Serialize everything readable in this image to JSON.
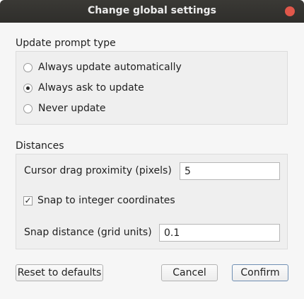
{
  "window": {
    "title": "Change global settings"
  },
  "update_prompt": {
    "heading": "Update prompt type",
    "options": [
      {
        "label": "Always update automatically",
        "selected": false
      },
      {
        "label": "Always ask to update",
        "selected": true
      },
      {
        "label": "Never update",
        "selected": false
      }
    ]
  },
  "distances": {
    "heading": "Distances",
    "drag_proximity": {
      "label": "Cursor drag proximity (pixels)",
      "value": "5"
    },
    "snap_checkbox": {
      "label": "Snap to integer coordinates",
      "checked": true,
      "mark": "✓"
    },
    "snap_distance": {
      "label": "Snap distance (grid units)",
      "value": "0.1"
    }
  },
  "buttons": {
    "reset": "Reset to defaults",
    "cancel": "Cancel",
    "confirm": "Confirm"
  },
  "colors": {
    "titlebar": "#2f2e2b",
    "close_button": "#e0574a",
    "background": "#f6f6f6",
    "group_background": "#efefef"
  }
}
